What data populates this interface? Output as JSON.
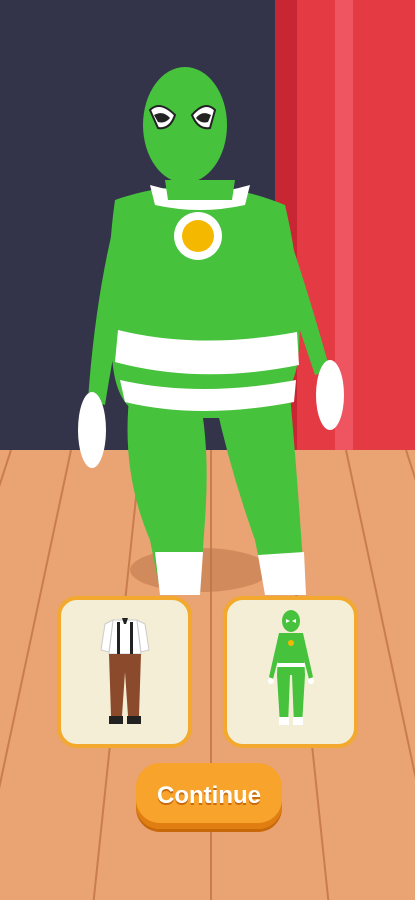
{
  "colors": {
    "wall": "#33334a",
    "curtain": "#e33a44",
    "floor": "#eaa373",
    "suit_green": "#46c23c",
    "card_border": "#f3a82e",
    "card_bg": "#f5eed6",
    "button": "#f7a32c"
  },
  "choices": [
    {
      "icon": "suspenders-outfit-icon"
    },
    {
      "icon": "green-hero-suit-icon"
    }
  ],
  "continue_label": "Continue"
}
